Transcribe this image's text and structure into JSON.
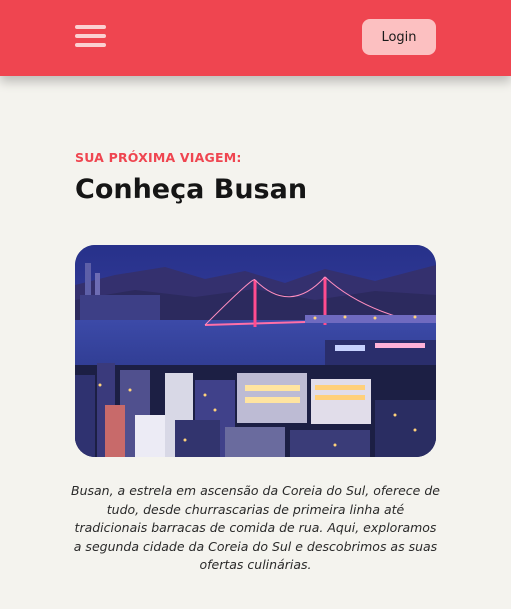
{
  "header": {
    "menu_icon": "hamburger-menu-icon",
    "login_label": "Login",
    "colors": {
      "background": "#ef4550",
      "button": "#fcc0c1"
    }
  },
  "main": {
    "eyebrow": "SUA PRÓXIMA VIAGEM:",
    "title": "Conheça Busan",
    "description": "Busan, a estrela em ascensão da Coreia do Sul, oferece de tudo, desde churrascarias de primeira linha até tradicionais barracas de comida de rua. Aqui, exploramos a segunda cidade da Coreia do Sul e descobrimos as suas ofertas culinárias."
  }
}
